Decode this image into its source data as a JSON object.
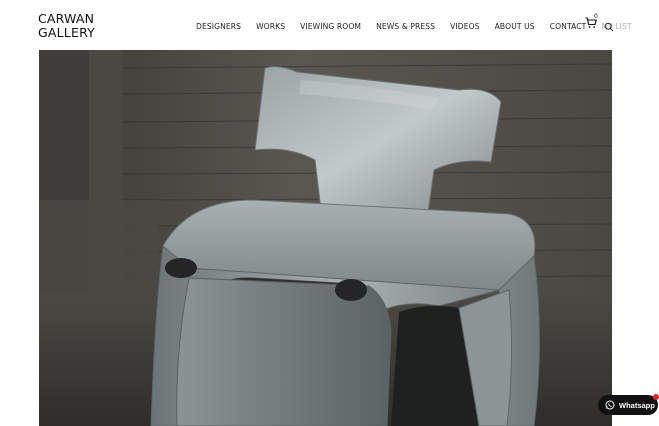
{
  "brand": {
    "line1": "CARWAN",
    "line2": "GALLERY"
  },
  "nav": {
    "items": [
      {
        "label": "DESIGNERS"
      },
      {
        "label": "WORKS"
      },
      {
        "label": "VIEWING ROOM"
      },
      {
        "label": "NEWS & PRESS"
      },
      {
        "label": "VIDEOS"
      },
      {
        "label": "ABOUT US"
      },
      {
        "label": "CONTACT"
      },
      {
        "label": "MY LIST"
      }
    ]
  },
  "cart": {
    "icon": "cart-icon",
    "count": "0"
  },
  "search": {
    "icon": "search-icon"
  },
  "hero": {
    "subject": "metal-chair-photo"
  },
  "whatsapp": {
    "label": "Whatsapp",
    "icon": "whatsapp-icon"
  }
}
